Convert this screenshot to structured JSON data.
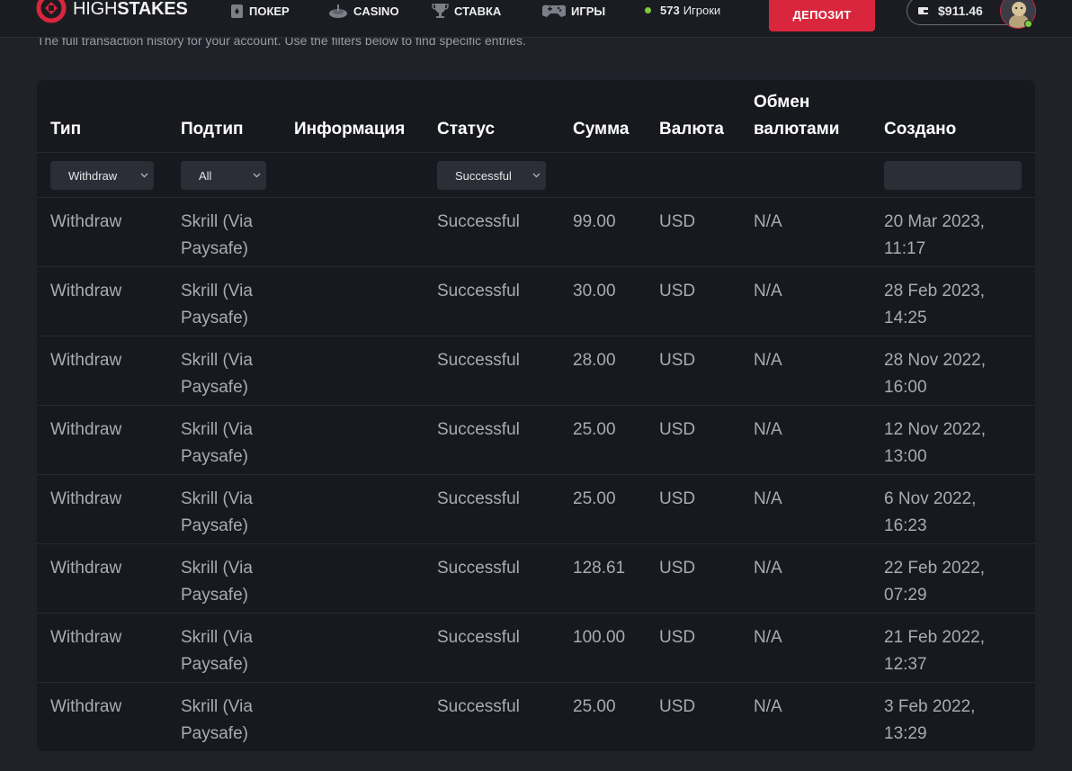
{
  "brand": {
    "name_light": "HIGH",
    "name_bold": "STAKES",
    "accent": "#d9263c"
  },
  "nav": [
    {
      "label": "ПОКЕР",
      "icon": "poker-card-icon"
    },
    {
      "label": "CASINO",
      "icon": "roulette-icon"
    },
    {
      "label": "СТАВКА",
      "icon": "trophy-icon"
    },
    {
      "label": "ИГРЫ",
      "icon": "gamepad-icon"
    }
  ],
  "players": {
    "count": "573",
    "label": "Игроки"
  },
  "deposit_label": "ДЕПОЗИТ",
  "balance": "$911.46",
  "subtitle": "The full transaction history for your account. Use the filters below to find specific entries.",
  "table": {
    "columns": {
      "type": "Тип",
      "subtype": "Подтип",
      "info": "Информация",
      "status": "Статус",
      "amount": "Сумма",
      "currency": "Валюта",
      "exchange_1": "Обмен",
      "exchange_2": "валютами",
      "created": "Создано"
    },
    "filters": {
      "type": "Withdraw",
      "subtype": "All",
      "status": "Successful",
      "created": ""
    },
    "rows": [
      {
        "type": "Withdraw",
        "sub1": "Skrill (Via",
        "sub2": "Paysafe)",
        "info": "",
        "status": "Successful",
        "amount": "99.00",
        "currency": "USD",
        "exchange": "N/A",
        "date1": "20 Mar 2023,",
        "date2": "11:17"
      },
      {
        "type": "Withdraw",
        "sub1": "Skrill (Via",
        "sub2": "Paysafe)",
        "info": "",
        "status": "Successful",
        "amount": "30.00",
        "currency": "USD",
        "exchange": "N/A",
        "date1": "28 Feb 2023,",
        "date2": "14:25"
      },
      {
        "type": "Withdraw",
        "sub1": "Skrill (Via",
        "sub2": "Paysafe)",
        "info": "",
        "status": "Successful",
        "amount": "28.00",
        "currency": "USD",
        "exchange": "N/A",
        "date1": "28 Nov 2022,",
        "date2": "16:00"
      },
      {
        "type": "Withdraw",
        "sub1": "Skrill (Via",
        "sub2": "Paysafe)",
        "info": "",
        "status": "Successful",
        "amount": "25.00",
        "currency": "USD",
        "exchange": "N/A",
        "date1": "12 Nov 2022,",
        "date2": "13:00"
      },
      {
        "type": "Withdraw",
        "sub1": "Skrill (Via",
        "sub2": "Paysafe)",
        "info": "",
        "status": "Successful",
        "amount": "25.00",
        "currency": "USD",
        "exchange": "N/A",
        "date1": "6 Nov 2022,",
        "date2": "16:23"
      },
      {
        "type": "Withdraw",
        "sub1": "Skrill (Via",
        "sub2": "Paysafe)",
        "info": "",
        "status": "Successful",
        "amount": "128.61",
        "currency": "USD",
        "exchange": "N/A",
        "date1": "22 Feb 2022,",
        "date2": "07:29"
      },
      {
        "type": "Withdraw",
        "sub1": "Skrill (Via",
        "sub2": "Paysafe)",
        "info": "",
        "status": "Successful",
        "amount": "100.00",
        "currency": "USD",
        "exchange": "N/A",
        "date1": "21 Feb 2022,",
        "date2": "12:37"
      },
      {
        "type": "Withdraw",
        "sub1": "Skrill (Via",
        "sub2": "Paysafe)",
        "info": "",
        "status": "Successful",
        "amount": "25.00",
        "currency": "USD",
        "exchange": "N/A",
        "date1": "3 Feb 2022,",
        "date2": "13:29"
      }
    ]
  }
}
